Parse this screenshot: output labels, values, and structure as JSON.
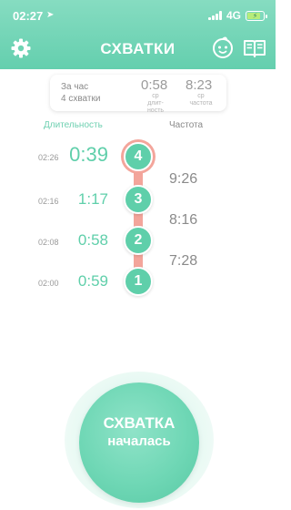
{
  "status_bar": {
    "time": "02:27",
    "network": "4G"
  },
  "header": {
    "title": "СХВАТКИ"
  },
  "summary": {
    "period_label": "За час",
    "count_label": "4 схватки",
    "avg_duration": {
      "value": "0:58",
      "label_line1": "ср",
      "label_line2": "длит-ность"
    },
    "avg_frequency": {
      "value": "8:23",
      "label_line1": "ср",
      "label_line2": "частота"
    }
  },
  "columns": {
    "duration": "Длительность",
    "frequency": "Частота"
  },
  "contractions": [
    {
      "number": "4",
      "start": "02:26",
      "duration": "0:39",
      "active": true
    },
    {
      "number": "3",
      "start": "02:16",
      "duration": "1:17",
      "active": false
    },
    {
      "number": "2",
      "start": "02:08",
      "duration": "0:58",
      "active": false
    },
    {
      "number": "1",
      "start": "02:00",
      "duration": "0:59",
      "active": false
    }
  ],
  "intervals": [
    "9:26",
    "8:16",
    "7:28"
  ],
  "main_button": {
    "line1": "СХВАТКА",
    "line2": "началась"
  },
  "colors": {
    "accent": "#5fcfaa",
    "rail": "#f3a59b",
    "header": "#6fd4b3"
  },
  "icons": [
    "location-arrow-icon",
    "signal-icon",
    "battery-charging-icon",
    "gear-icon",
    "baby-face-icon",
    "book-icon"
  ]
}
